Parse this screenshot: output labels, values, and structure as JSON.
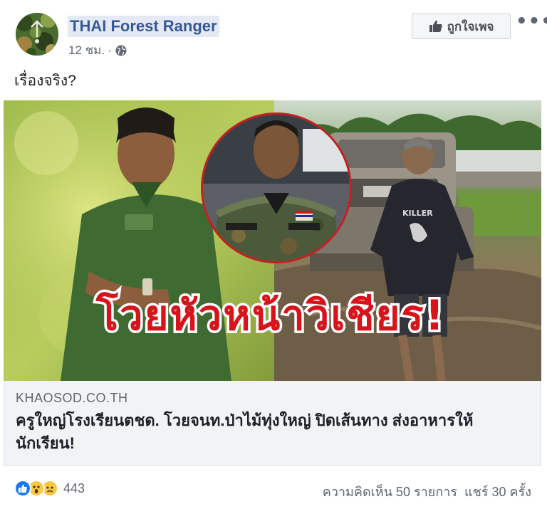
{
  "post": {
    "page_name": "THAI Forest Ranger",
    "time": "12 ชม.",
    "separator": "·",
    "like_page_label": "ถูกใจเพจ",
    "more_label": "•••",
    "text": "เรื่องจริง?",
    "photo": {
      "headline_overlay": "โวยหัวหน้าวิเชียร!"
    },
    "link": {
      "domain": "KHAOSOD.CO.TH",
      "title": "ครูใหญ่โรงเรียนตชด. โวยจนท.ป่าไม้ทุ่งใหญ่ ปิดเส้นทาง ส่งอาหารให้นักเรียน!"
    },
    "footer": {
      "reaction_count": "443",
      "comments": "ความคิดเห็น 50 รายการ",
      "shares": "แชร์ 30 ครั้ง"
    }
  },
  "colors": {
    "link_blue": "#365899",
    "overlay_red": "#d7141c",
    "like_blue": "#1877f2",
    "wow_yellow": "#f7c843"
  },
  "icons": [
    "avatar-camo",
    "globe-icon",
    "thumbs-up-icon",
    "more-icon",
    "like-reaction-icon",
    "wow-reaction-icon",
    "sad-reaction-icon"
  ]
}
